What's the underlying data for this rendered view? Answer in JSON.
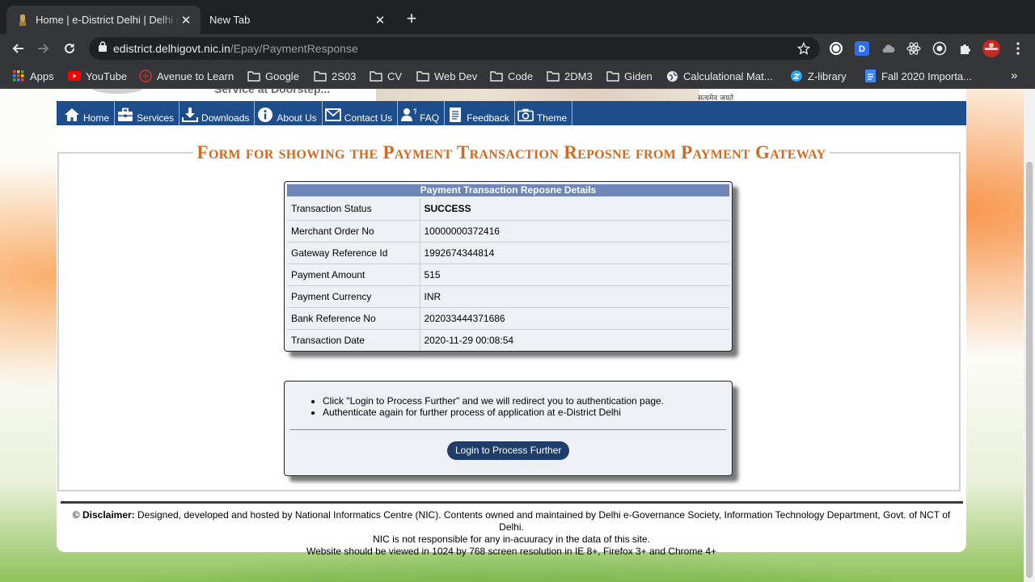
{
  "browser": {
    "tabs": [
      {
        "title": "Home | e-District Delhi | Delhi e-Governance Society",
        "active": true
      },
      {
        "title": "New Tab",
        "active": false
      }
    ],
    "url_host": "edistrict.delhigovt.nic.in",
    "url_path": "/Epay/PaymentResponse",
    "bookmarks": [
      "Apps",
      "YouTube",
      "Avenue to Learn",
      "Google",
      "2S03",
      "CV",
      "Web Dev",
      "Code",
      "2DM3",
      "Giden",
      "Calculational Mat...",
      "Z-library",
      "Fall 2020 Importa..."
    ],
    "extension_letter": "D"
  },
  "header": {
    "service_text": "Service at Doorstep...",
    "emblem_text": "सत्यमेव जयते"
  },
  "nav": [
    {
      "label": "Home",
      "icon": "home-icon"
    },
    {
      "label": "Services",
      "icon": "briefcase-icon"
    },
    {
      "label": "Downloads",
      "icon": "download-icon"
    },
    {
      "label": "About Us",
      "icon": "info-icon"
    },
    {
      "label": "Contact Us",
      "icon": "envelope-icon"
    },
    {
      "label": "FAQ",
      "icon": "faq-icon"
    },
    {
      "label": "Feedback",
      "icon": "document-icon"
    },
    {
      "label": "Theme",
      "icon": "camera-icon"
    }
  ],
  "form": {
    "title": "Form for showing the Payment Transaction Reposne from Payment Gateway",
    "details_heading": "Payment Transaction Reposne Details",
    "details": [
      {
        "label": "Transaction Status",
        "value": "SUCCESS"
      },
      {
        "label": "Merchant Order No",
        "value": "10000000372416"
      },
      {
        "label": "Gateway Reference Id",
        "value": "1992674344814"
      },
      {
        "label": "Payment Amount",
        "value": "515"
      },
      {
        "label": "Payment Currency",
        "value": "INR"
      },
      {
        "label": "Bank Reference No",
        "value": "202033444371686"
      },
      {
        "label": "Transaction Date",
        "value": "2020-11-29 00:08:54"
      }
    ],
    "notes": [
      "Click \"Login to Process Further\" and we will redirect you to authentication page.",
      "Authenticate again for further process of application at e-District Delhi"
    ],
    "login_button": "Login to Process Further"
  },
  "footer": {
    "disclaimer_prefix": "© ",
    "disclaimer_label": "Disclaimer:",
    "disclaimer_text": " Designed, developed and hosted by National Informatics Centre (NIC). Contents owned and maintained by Delhi e-Governance Society, Information Technology Department, Govt. of NCT of Delhi.",
    "line2": "NIC is not responsible for any in-acuuracy in the data of this site.",
    "line3": "Website should be viewed in 1024 by 768 screen resolution in IE 8+, Firefox 3+ and Chrome 4+"
  },
  "colors": {
    "nav_bg": "#1e4d8c",
    "title_orange": "#d2691e",
    "table_head": "#6f86b6",
    "button_bg": "#1f3d6a"
  }
}
